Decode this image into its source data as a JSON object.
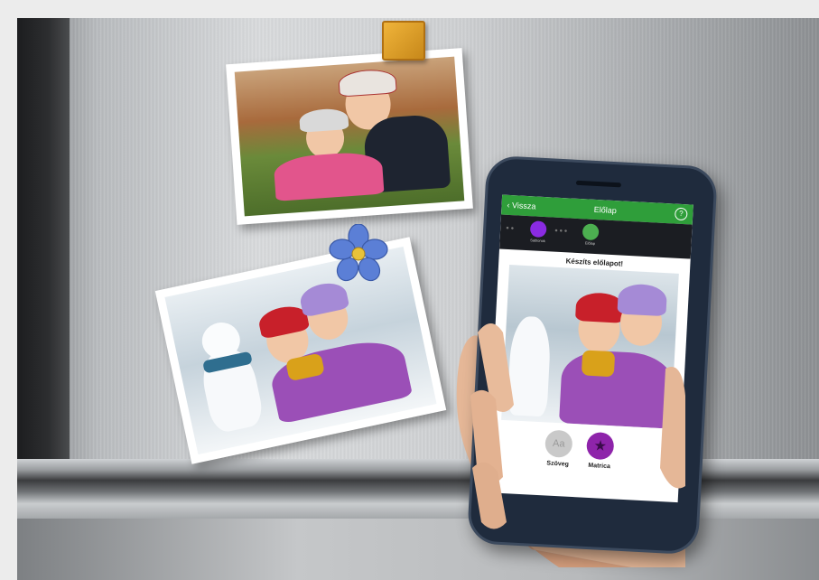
{
  "phone_app": {
    "back_label": "Vissza",
    "title": "Előlap",
    "help_symbol": "?",
    "steps": [
      {
        "label": "Sablonok"
      },
      {
        "label": "Előlap"
      }
    ],
    "heading": "Készíts előlapot!",
    "tools": [
      {
        "label": "Szöveg",
        "glyph": "Aa"
      },
      {
        "label": "Matrica",
        "glyph": "★"
      }
    ]
  },
  "colors": {
    "app_green": "#2f9e3a",
    "step_purple": "#8a2be2",
    "step_green": "#4caf50",
    "sticker_purple": "#8e24aa",
    "text_tool_gray": "#c9c9c9"
  },
  "icons": [
    "back-chevron-icon",
    "help-icon",
    "templates-icon",
    "cover-icon",
    "text-tool-icon",
    "star-sticker-icon"
  ]
}
